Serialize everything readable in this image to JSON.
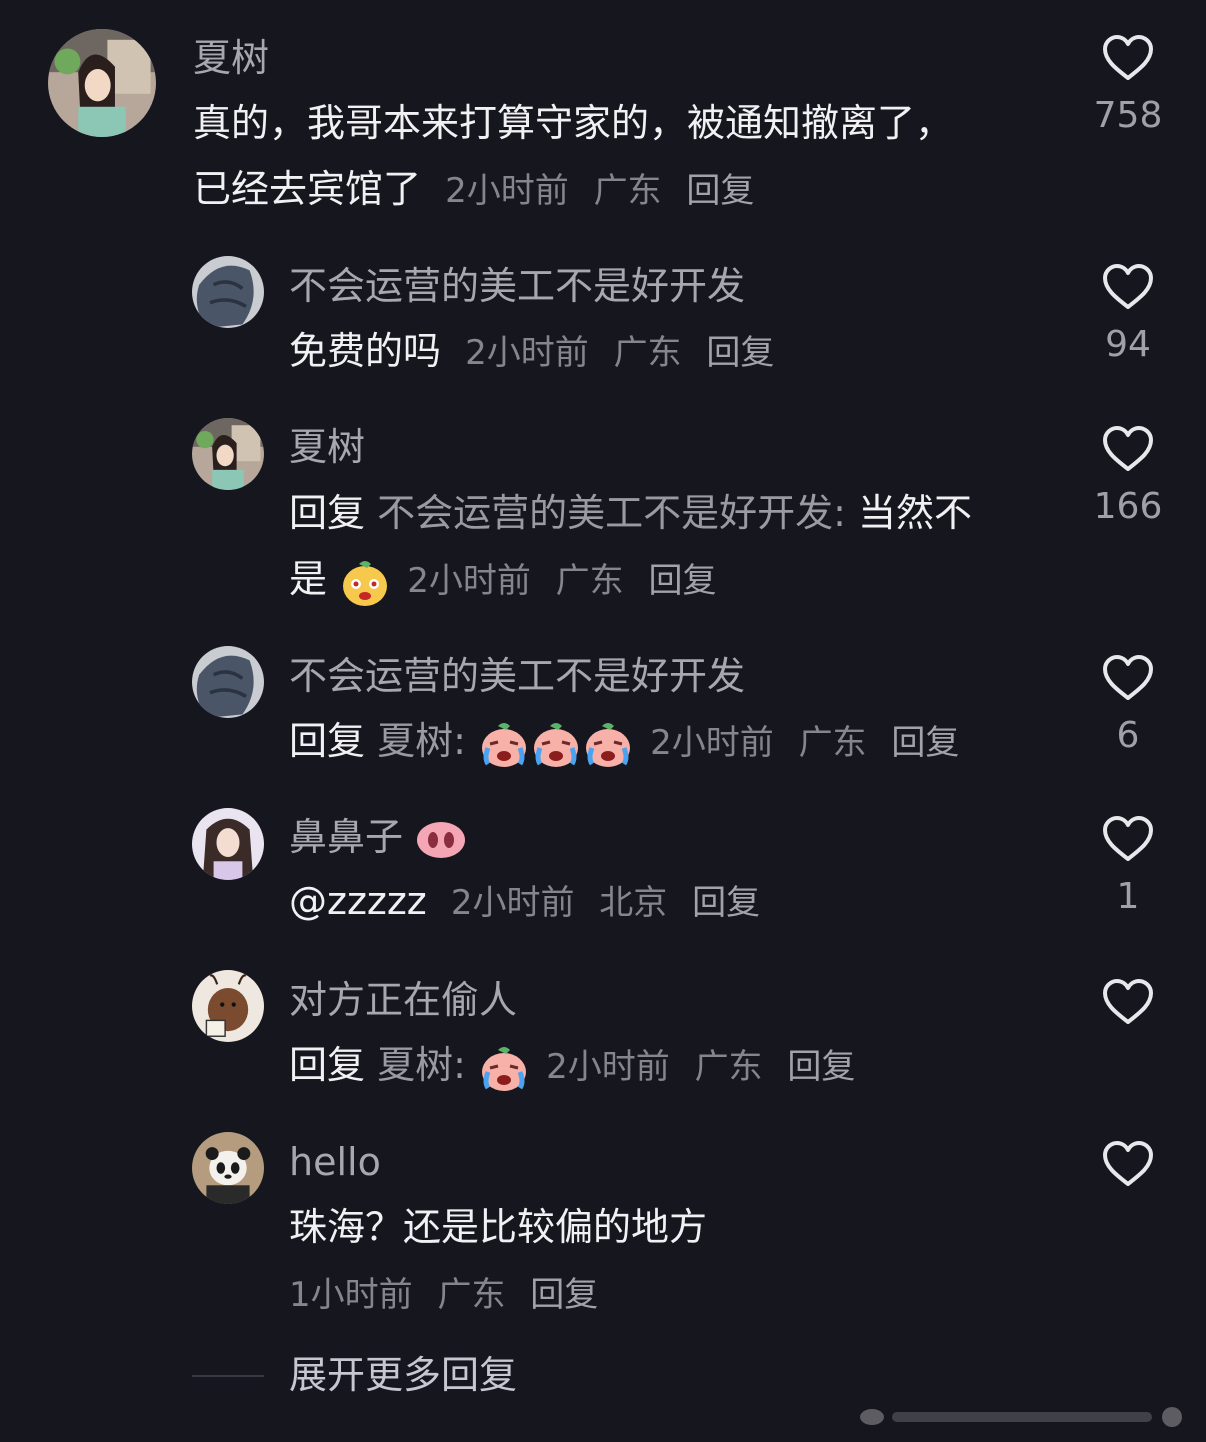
{
  "comments": [
    {
      "author": "夏树",
      "text": "真的，我哥本来打算守家的，被通知撤离了，",
      "text2": "已经去宾馆了",
      "time": "2小时前",
      "location": "广东",
      "reply_label": "回复",
      "likes": "758"
    },
    {
      "author": "不会运营的美工不是好开发",
      "text": "免费的吗",
      "time": "2小时前",
      "location": "广东",
      "reply_label": "回复",
      "likes": "94"
    },
    {
      "author": "夏树",
      "reply_prefix": "回复",
      "reply_target": "不会运营的美工不是好开发:",
      "text": "当然不",
      "text2": "是",
      "time": "2小时前",
      "location": "广东",
      "reply_label": "回复",
      "likes": "166"
    },
    {
      "author": "不会运营的美工不是好开发",
      "reply_prefix": "回复",
      "reply_target": "夏树:",
      "time": "2小时前",
      "location": "广东",
      "reply_label": "回复",
      "likes": "6"
    },
    {
      "author": "鼻鼻子",
      "text": "@zzzzz",
      "time": "2小时前",
      "location": "北京",
      "reply_label": "回复",
      "likes": "1"
    },
    {
      "author": "对方正在偷人",
      "reply_prefix": "回复",
      "reply_target": "夏树:",
      "time": "2小时前",
      "location": "广东",
      "reply_label": "回复",
      "likes": ""
    },
    {
      "author": "hello",
      "text": "珠海？还是比较偏的地方",
      "time": "1小时前",
      "location": "广东",
      "reply_label": "回复",
      "likes": ""
    }
  ],
  "expand_more": "展开更多回复",
  "colors": {
    "background": "#16161e",
    "primary_text": "#f1f1f4",
    "secondary_text": "#a7a7ae"
  },
  "icons": [
    "heart-outline-icon",
    "pig-nose-emoji",
    "crying-face-emoji",
    "smiling-face-emoji"
  ]
}
